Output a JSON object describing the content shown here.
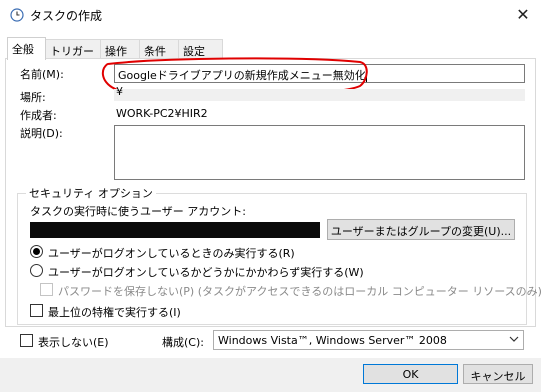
{
  "window": {
    "title": "タスクの作成",
    "close_glyph": "✕"
  },
  "tabs": [
    {
      "label": "全般",
      "active": true
    },
    {
      "label": "トリガー",
      "active": false
    },
    {
      "label": "操作",
      "active": false
    },
    {
      "label": "条件",
      "active": false
    },
    {
      "label": "設定",
      "active": false
    }
  ],
  "general": {
    "name_label": "名前(M):",
    "name_value": "Googleドライブアプリの新規作成メニュー無効化",
    "location_label": "場所:",
    "location_value": "¥",
    "author_label": "作成者:",
    "author_value": "WORK-PC2¥HIR2",
    "description_label": "説明(D):",
    "description_value": ""
  },
  "security": {
    "group_label": "セキュリティ オプション",
    "account_prompt": "タスクの実行時に使うユーザー アカウント:",
    "change_button": "ユーザーまたはグループの変更(U)...",
    "radio_logged_on": "ユーザーがログオンしているときのみ実行する(R)",
    "radio_whether": "ユーザーがログオンしているかどうかにかかわらず実行する(W)",
    "radio_selected": "logged_on",
    "no_store_password": "パスワードを保存しない(P) (タスクがアクセスできるのはローカル コンピューター リソースのみ)",
    "highest_privileges": "最上位の特権で実行する(I)"
  },
  "bottom": {
    "hidden_label": "表示しない(E)",
    "configure_label": "構成(C):",
    "configure_value": "Windows Vista™, Windows Server™ 2008"
  },
  "buttons": {
    "ok": "OK",
    "cancel": "キャンセル"
  },
  "colors": {
    "annotation": "#e00000",
    "accent": "#0078d7"
  }
}
